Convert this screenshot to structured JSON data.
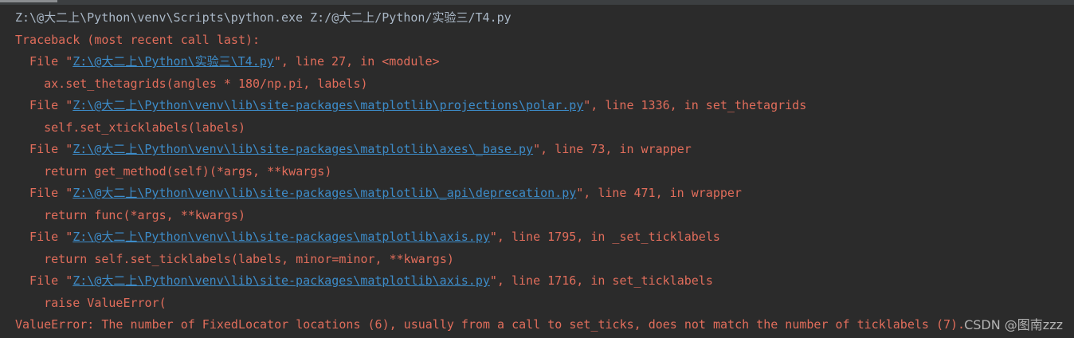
{
  "console": {
    "command": "Z:\\@大二上\\Python\\venv\\Scripts\\python.exe Z:/@大二上/Python/实验三/T4.py",
    "traceback_header": "Traceback (most recent call last):",
    "frames": [
      {
        "file": "Z:\\@大二上\\Python\\实验三\\T4.py",
        "suffix": "\", line 27, in <module>",
        "code": "ax.set_thetagrids(angles * 180/np.pi, labels)"
      },
      {
        "file": "Z:\\@大二上\\Python\\venv\\lib\\site-packages\\matplotlib\\projections\\polar.py",
        "suffix": "\", line 1336, in set_thetagrids",
        "code": "self.set_xticklabels(labels)"
      },
      {
        "file": "Z:\\@大二上\\Python\\venv\\lib\\site-packages\\matplotlib\\axes\\_base.py",
        "suffix": "\", line 73, in wrapper",
        "code": "return get_method(self)(*args, **kwargs)"
      },
      {
        "file": "Z:\\@大二上\\Python\\venv\\lib\\site-packages\\matplotlib\\_api\\deprecation.py",
        "suffix": "\", line 471, in wrapper",
        "code": "return func(*args, **kwargs)"
      },
      {
        "file": "Z:\\@大二上\\Python\\venv\\lib\\site-packages\\matplotlib\\axis.py",
        "suffix": "\", line 1795, in _set_ticklabels",
        "code": "return self.set_ticklabels(labels, minor=minor, **kwargs)"
      },
      {
        "file": "Z:\\@大二上\\Python\\venv\\lib\\site-packages\\matplotlib\\axis.py",
        "suffix": "\", line 1716, in set_ticklabels",
        "code": "raise ValueError("
      }
    ],
    "error_message": "ValueError: The number of FixedLocator locations (6), usually from a call to set_ticks, does not match the number of ticklabels (7)."
  },
  "watermark": "CSDN @图南zzz",
  "colors": {
    "background": "#2b2b2b",
    "command_text": "#a9b7c6",
    "error_text": "#e16d5b",
    "link": "#3d8cc9"
  }
}
